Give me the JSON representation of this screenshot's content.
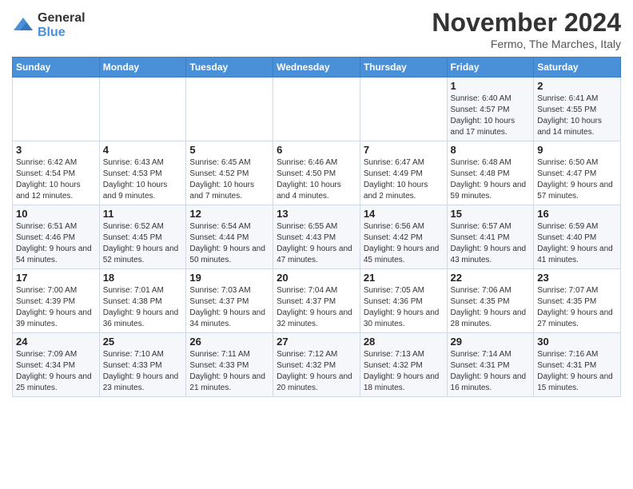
{
  "logo": {
    "general": "General",
    "blue": "Blue"
  },
  "header": {
    "title": "November 2024",
    "location": "Fermo, The Marches, Italy"
  },
  "weekdays": [
    "Sunday",
    "Monday",
    "Tuesday",
    "Wednesday",
    "Thursday",
    "Friday",
    "Saturday"
  ],
  "weeks": [
    [
      {
        "day": "",
        "info": ""
      },
      {
        "day": "",
        "info": ""
      },
      {
        "day": "",
        "info": ""
      },
      {
        "day": "",
        "info": ""
      },
      {
        "day": "",
        "info": ""
      },
      {
        "day": "1",
        "info": "Sunrise: 6:40 AM\nSunset: 4:57 PM\nDaylight: 10 hours and 17 minutes."
      },
      {
        "day": "2",
        "info": "Sunrise: 6:41 AM\nSunset: 4:55 PM\nDaylight: 10 hours and 14 minutes."
      }
    ],
    [
      {
        "day": "3",
        "info": "Sunrise: 6:42 AM\nSunset: 4:54 PM\nDaylight: 10 hours and 12 minutes."
      },
      {
        "day": "4",
        "info": "Sunrise: 6:43 AM\nSunset: 4:53 PM\nDaylight: 10 hours and 9 minutes."
      },
      {
        "day": "5",
        "info": "Sunrise: 6:45 AM\nSunset: 4:52 PM\nDaylight: 10 hours and 7 minutes."
      },
      {
        "day": "6",
        "info": "Sunrise: 6:46 AM\nSunset: 4:50 PM\nDaylight: 10 hours and 4 minutes."
      },
      {
        "day": "7",
        "info": "Sunrise: 6:47 AM\nSunset: 4:49 PM\nDaylight: 10 hours and 2 minutes."
      },
      {
        "day": "8",
        "info": "Sunrise: 6:48 AM\nSunset: 4:48 PM\nDaylight: 9 hours and 59 minutes."
      },
      {
        "day": "9",
        "info": "Sunrise: 6:50 AM\nSunset: 4:47 PM\nDaylight: 9 hours and 57 minutes."
      }
    ],
    [
      {
        "day": "10",
        "info": "Sunrise: 6:51 AM\nSunset: 4:46 PM\nDaylight: 9 hours and 54 minutes."
      },
      {
        "day": "11",
        "info": "Sunrise: 6:52 AM\nSunset: 4:45 PM\nDaylight: 9 hours and 52 minutes."
      },
      {
        "day": "12",
        "info": "Sunrise: 6:54 AM\nSunset: 4:44 PM\nDaylight: 9 hours and 50 minutes."
      },
      {
        "day": "13",
        "info": "Sunrise: 6:55 AM\nSunset: 4:43 PM\nDaylight: 9 hours and 47 minutes."
      },
      {
        "day": "14",
        "info": "Sunrise: 6:56 AM\nSunset: 4:42 PM\nDaylight: 9 hours and 45 minutes."
      },
      {
        "day": "15",
        "info": "Sunrise: 6:57 AM\nSunset: 4:41 PM\nDaylight: 9 hours and 43 minutes."
      },
      {
        "day": "16",
        "info": "Sunrise: 6:59 AM\nSunset: 4:40 PM\nDaylight: 9 hours and 41 minutes."
      }
    ],
    [
      {
        "day": "17",
        "info": "Sunrise: 7:00 AM\nSunset: 4:39 PM\nDaylight: 9 hours and 39 minutes."
      },
      {
        "day": "18",
        "info": "Sunrise: 7:01 AM\nSunset: 4:38 PM\nDaylight: 9 hours and 36 minutes."
      },
      {
        "day": "19",
        "info": "Sunrise: 7:03 AM\nSunset: 4:37 PM\nDaylight: 9 hours and 34 minutes."
      },
      {
        "day": "20",
        "info": "Sunrise: 7:04 AM\nSunset: 4:37 PM\nDaylight: 9 hours and 32 minutes."
      },
      {
        "day": "21",
        "info": "Sunrise: 7:05 AM\nSunset: 4:36 PM\nDaylight: 9 hours and 30 minutes."
      },
      {
        "day": "22",
        "info": "Sunrise: 7:06 AM\nSunset: 4:35 PM\nDaylight: 9 hours and 28 minutes."
      },
      {
        "day": "23",
        "info": "Sunrise: 7:07 AM\nSunset: 4:35 PM\nDaylight: 9 hours and 27 minutes."
      }
    ],
    [
      {
        "day": "24",
        "info": "Sunrise: 7:09 AM\nSunset: 4:34 PM\nDaylight: 9 hours and 25 minutes."
      },
      {
        "day": "25",
        "info": "Sunrise: 7:10 AM\nSunset: 4:33 PM\nDaylight: 9 hours and 23 minutes."
      },
      {
        "day": "26",
        "info": "Sunrise: 7:11 AM\nSunset: 4:33 PM\nDaylight: 9 hours and 21 minutes."
      },
      {
        "day": "27",
        "info": "Sunrise: 7:12 AM\nSunset: 4:32 PM\nDaylight: 9 hours and 20 minutes."
      },
      {
        "day": "28",
        "info": "Sunrise: 7:13 AM\nSunset: 4:32 PM\nDaylight: 9 hours and 18 minutes."
      },
      {
        "day": "29",
        "info": "Sunrise: 7:14 AM\nSunset: 4:31 PM\nDaylight: 9 hours and 16 minutes."
      },
      {
        "day": "30",
        "info": "Sunrise: 7:16 AM\nSunset: 4:31 PM\nDaylight: 9 hours and 15 minutes."
      }
    ]
  ]
}
